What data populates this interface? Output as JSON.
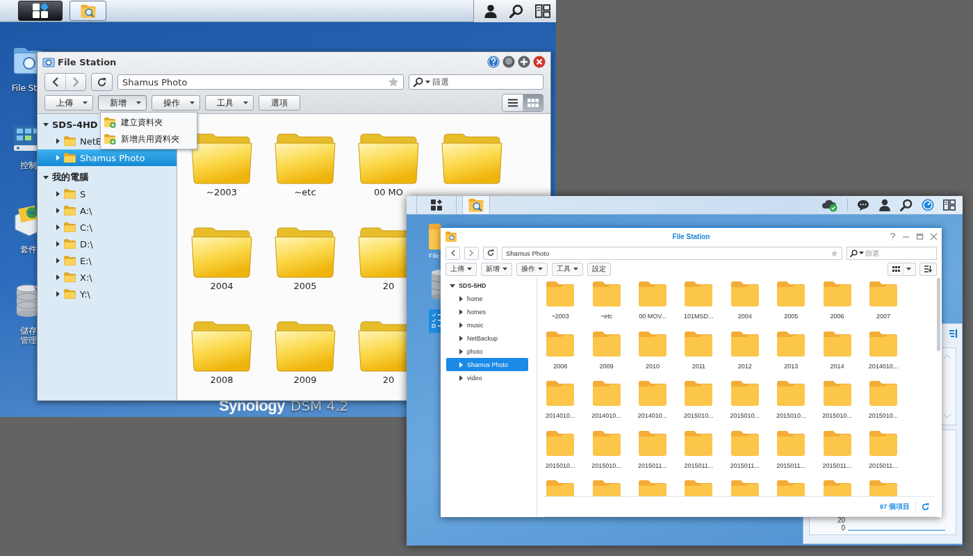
{
  "dsm4_screen": {
    "desktop_icons": [
      {
        "kind": "file-station",
        "lines": [
          "File St"
        ]
      },
      {
        "kind": "control-panel",
        "lines": [
          "控制"
        ]
      },
      {
        "kind": "package-center",
        "lines": [
          "套件"
        ]
      },
      {
        "kind": "storage-manager",
        "lines": [
          "儲存",
          "管理"
        ]
      }
    ],
    "window": {
      "title": "File Station",
      "path": "Shamus Photo",
      "search_placeholder": "篩選",
      "toolbar": [
        {
          "label": "上傳",
          "dropdown": true,
          "open": false
        },
        {
          "label": "新增",
          "dropdown": true,
          "open": true
        },
        {
          "label": "操作",
          "dropdown": true,
          "open": false
        },
        {
          "label": "工具",
          "dropdown": true,
          "open": false
        },
        {
          "label": "選項",
          "dropdown": false,
          "open": false
        }
      ],
      "views": [
        {
          "kind": "list",
          "selected": false
        },
        {
          "kind": "grid",
          "selected": true
        }
      ],
      "menu": [
        {
          "label": "建立資料夾"
        },
        {
          "label": "新增共用資料夾"
        }
      ],
      "tree": [
        {
          "label": "SDS-4HD",
          "expanded": true,
          "selected": false,
          "children": [
            {
              "label": "NetB",
              "expanded": false,
              "selected": false
            },
            {
              "label": "Shamus Photo",
              "expanded": false,
              "selected": true
            }
          ]
        },
        {
          "label": "我的電腦",
          "expanded": true,
          "selected": false,
          "children": [
            {
              "label": "S",
              "expanded": false,
              "selected": false
            },
            {
              "label": "A:\\",
              "expanded": false,
              "selected": false
            },
            {
              "label": "C:\\",
              "expanded": false,
              "selected": false
            },
            {
              "label": "D:\\",
              "expanded": false,
              "selected": false
            },
            {
              "label": "E:\\",
              "expanded": false,
              "selected": false
            },
            {
              "label": "X:\\",
              "expanded": false,
              "selected": false
            },
            {
              "label": "Y:\\",
              "expanded": false,
              "selected": false
            }
          ]
        }
      ],
      "folder_rows": [
        [
          {
            "kind": "folder",
            "label": "~2003"
          },
          {
            "kind": "folder",
            "label": "~etc"
          },
          {
            "kind": "folder",
            "label": "00 MO"
          },
          {
            "kind": "folder"
          }
        ],
        [
          {
            "kind": "folder",
            "label": "2004"
          },
          {
            "kind": "folder",
            "label": "2005"
          },
          {
            "kind": "folder",
            "label": "20"
          }
        ],
        [
          {
            "kind": "folder",
            "label": "2008"
          },
          {
            "kind": "folder",
            "label": "2009"
          },
          {
            "kind": "folder",
            "label": "20"
          }
        ]
      ]
    },
    "brand": {
      "name": "Synology",
      "version": "DSM 4.2"
    }
  },
  "dsm5_screen": {
    "desktop_icons": [
      {
        "kind": "file-station",
        "lines": [
          "File"
        ]
      },
      {
        "kind": "storage-manager"
      },
      {
        "kind": "control-panel"
      }
    ],
    "window": {
      "title": "File Station",
      "path": "Shamus Photo",
      "search_placeholder": "篩選",
      "toolbar": [
        {
          "label": "上傳",
          "dropdown": true
        },
        {
          "label": "新增",
          "dropdown": true
        },
        {
          "label": "操作",
          "dropdown": true
        },
        {
          "label": "工具",
          "dropdown": true
        },
        {
          "label": "設定",
          "dropdown": false
        }
      ],
      "tree": [
        {
          "label": "SDS-5HD",
          "expanded": true,
          "selected": false,
          "children": [
            {
              "label": "home",
              "expanded": false,
              "selected": false
            },
            {
              "label": "homes",
              "expanded": false,
              "selected": false
            },
            {
              "label": "music",
              "expanded": false,
              "selected": false
            },
            {
              "label": "NetBackup",
              "expanded": false,
              "selected": false
            },
            {
              "label": "photo",
              "expanded": false,
              "selected": false
            },
            {
              "label": "Shamus Photo",
              "expanded": false,
              "selected": true
            },
            {
              "label": "video",
              "expanded": false,
              "selected": false
            }
          ]
        }
      ],
      "folder_rows": [
        [
          {
            "kind": "folder",
            "label": "~2003"
          },
          {
            "kind": "folder",
            "label": "~etc"
          },
          {
            "kind": "folder",
            "label": "00 MOV..."
          },
          {
            "kind": "folder",
            "label": "101MSD..."
          },
          {
            "kind": "folder",
            "label": "2004"
          },
          {
            "kind": "folder",
            "label": "2005"
          },
          {
            "kind": "folder",
            "label": "2006"
          },
          {
            "kind": "folder",
            "label": "2007"
          }
        ],
        [
          {
            "kind": "folder",
            "label": "2008"
          },
          {
            "kind": "folder",
            "label": "2009"
          },
          {
            "kind": "folder",
            "label": "2010"
          },
          {
            "kind": "folder",
            "label": "2011"
          },
          {
            "kind": "folder",
            "label": "2012"
          },
          {
            "kind": "folder",
            "label": "2013"
          },
          {
            "kind": "folder",
            "label": "2014"
          },
          {
            "kind": "folder",
            "label": "2014010..."
          }
        ],
        [
          {
            "kind": "folder",
            "label": "2014010..."
          },
          {
            "kind": "folder",
            "label": "2014010..."
          },
          {
            "kind": "folder",
            "label": "2014010..."
          },
          {
            "kind": "folder",
            "label": "2015010..."
          },
          {
            "kind": "folder",
            "label": "2015010..."
          },
          {
            "kind": "folder",
            "label": "2015010..."
          },
          {
            "kind": "folder",
            "label": "2015010..."
          },
          {
            "kind": "folder",
            "label": "2015010..."
          }
        ],
        [
          {
            "kind": "folder",
            "label": "2015010..."
          },
          {
            "kind": "folder",
            "label": "2015010..."
          },
          {
            "kind": "folder",
            "label": "2015011..."
          },
          {
            "kind": "folder",
            "label": "2015011..."
          },
          {
            "kind": "folder",
            "label": "2015011..."
          },
          {
            "kind": "folder",
            "label": "2015011..."
          },
          {
            "kind": "folder",
            "label": "2015011..."
          },
          {
            "kind": "folder",
            "label": "2015011..."
          }
        ],
        [
          {
            "kind": "folder"
          },
          {
            "kind": "folder"
          },
          {
            "kind": "folder"
          },
          {
            "kind": "folder"
          },
          {
            "kind": "folder"
          },
          {
            "kind": "folder"
          },
          {
            "kind": "folder"
          },
          {
            "kind": "folder"
          }
        ]
      ],
      "item_count": "97 個項目"
    },
    "widget": {
      "tick_labels": [
        "20",
        "0"
      ]
    }
  }
}
